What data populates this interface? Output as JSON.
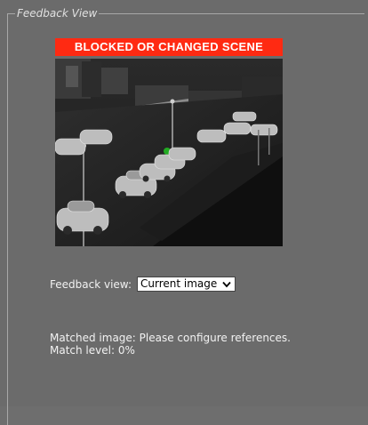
{
  "group": {
    "title": "Feedback View"
  },
  "banner": {
    "text": "BLOCKED OR CHANGED SCENE",
    "color": "#ff2a12"
  },
  "camera": {
    "description_icon": "thermal-camera-feed"
  },
  "feedback_view": {
    "label": "Feedback view:",
    "selected": "Current image",
    "icon": "chevron-down-icon"
  },
  "status": {
    "matched_image": "Matched image: Please configure references.",
    "match_level": "Match level: 0%"
  }
}
